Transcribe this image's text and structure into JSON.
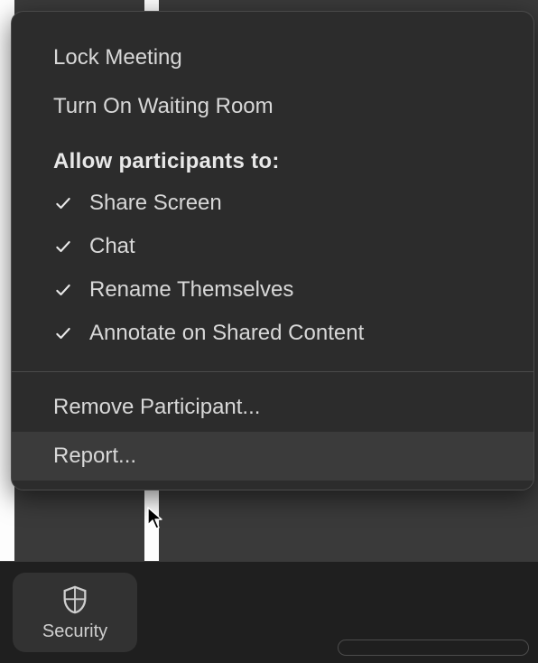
{
  "menu": {
    "lock_meeting": "Lock Meeting",
    "waiting_room": "Turn On Waiting Room",
    "allow_header": "Allow participants to:",
    "options": {
      "share_screen": {
        "label": "Share Screen",
        "checked": true
      },
      "chat": {
        "label": "Chat",
        "checked": true
      },
      "rename": {
        "label": "Rename Themselves",
        "checked": true
      },
      "annotate": {
        "label": "Annotate on Shared Content",
        "checked": true
      }
    },
    "remove_participant": "Remove Participant...",
    "report": "Report..."
  },
  "toolbar": {
    "security_label": "Security"
  }
}
